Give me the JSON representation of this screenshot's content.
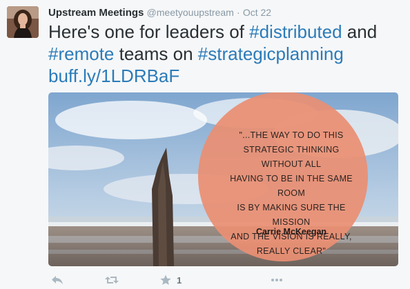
{
  "tweet": {
    "author_name": "Upstream Meetings",
    "author_handle": "@meetyouupstream",
    "separator": "·",
    "timestamp": "Oct 22",
    "text_parts": {
      "t1": "Here's one for leaders of ",
      "h1": "#distributed",
      "t2": " and ",
      "h2": "#remote",
      "t3": " teams on ",
      "h3": "#strategicplanning",
      "link": "buff.ly/1LDRBaF"
    }
  },
  "media": {
    "quote_lines": [
      "\"...The way to do this",
      "strategic thinking without all",
      "having to be in the same room",
      "is by making sure the mission",
      "and the vision is really,",
      "really clear\""
    ],
    "author": "Carrie McKeegan",
    "circle_color": "#ea8f73"
  },
  "actions": {
    "reply_icon": "reply-icon",
    "retweet_icon": "retweet-icon",
    "favorite_icon": "star-icon",
    "favorite_count": "1",
    "more_icon": "more-dots-icon"
  }
}
